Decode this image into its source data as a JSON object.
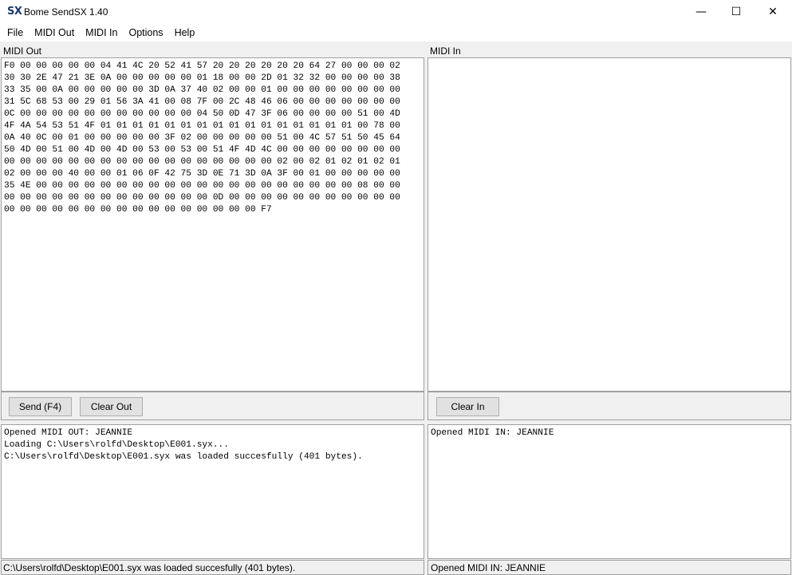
{
  "window": {
    "icon_text": "SX",
    "title": "Bome SendSX 1.40",
    "min_glyph": "—",
    "max_glyph": "☐",
    "close_glyph": "✕"
  },
  "menu": [
    "File",
    "MIDI Out",
    "MIDI In",
    "Options",
    "Help"
  ],
  "midi_out": {
    "label": "MIDI Out",
    "hex": "F0 00 00 00 00 00 04 41 4C 20 52 41 57 20 20 20 20 20 20 64 27 00 00 00 02\n30 30 2E 47 21 3E 0A 00 00 00 00 00 01 18 00 00 2D 01 32 32 00 00 00 00 38\n33 35 00 0A 00 00 00 00 00 3D 0A 37 40 02 00 00 01 00 00 00 00 00 00 00 00\n31 5C 68 53 00 29 01 56 3A 41 00 08 7F 00 2C 48 46 06 00 00 00 00 00 00 00\n0C 00 00 00 00 00 00 00 00 00 00 00 04 50 0D 47 3F 06 00 00 00 00 51 00 4D\n4F 4A 54 53 51 4F 01 01 01 01 01 01 01 01 01 01 01 01 01 01 01 01 00 78 00\n0A 40 0C 00 01 00 00 00 00 00 3F 02 00 00 00 00 00 51 00 4C 57 51 50 45 64\n50 4D 00 51 00 4D 00 4D 00 53 00 53 00 51 4F 4D 4C 00 00 00 00 00 00 00 00\n00 00 00 00 00 00 00 00 00 00 00 00 00 00 00 00 00 02 00 02 01 02 01 02 01\n02 00 00 00 40 00 00 01 06 0F 42 75 3D 0E 71 3D 0A 3F 00 01 00 00 00 00 00\n35 4E 00 00 00 00 00 00 00 00 00 00 00 00 00 00 00 00 00 00 00 00 08 00 00\n00 00 00 00 00 00 00 00 00 00 00 00 00 0D 00 00 00 00 00 00 00 00 00 00 00\n00 00 00 00 00 00 00 00 00 00 00 00 00 00 00 00 F7",
    "send_label": "Send (F4)",
    "clear_label": "Clear Out",
    "log": "Opened MIDI OUT: JEANNIE\nLoading C:\\Users\\rolfd\\Desktop\\E001.syx...\nC:\\Users\\rolfd\\Desktop\\E001.syx was loaded succesfully (401 bytes)."
  },
  "midi_in": {
    "label": "MIDI In",
    "clear_label": "Clear In",
    "log": "Opened MIDI IN: JEANNIE"
  },
  "status": {
    "left": "C:\\Users\\rolfd\\Desktop\\E001.syx was loaded succesfully (401 bytes).",
    "right": "Opened MIDI IN: JEANNIE"
  }
}
